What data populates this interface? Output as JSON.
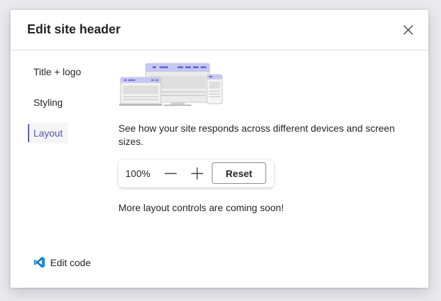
{
  "dialog": {
    "title": "Edit site header",
    "close_icon": "close-icon"
  },
  "nav": {
    "items": [
      {
        "label": "Title + logo",
        "active": false
      },
      {
        "label": "Styling",
        "active": false
      },
      {
        "label": "Layout",
        "active": true
      }
    ],
    "accent_color": "#5b5fc7"
  },
  "layout": {
    "illustration_icon": "responsive-devices-illustration",
    "description": "See how your site responds across different devices and screen sizes.",
    "zoom": {
      "value": "100%",
      "decrease_icon": "minus-icon",
      "increase_icon": "plus-icon",
      "reset_label": "Reset"
    },
    "coming_soon": "More layout controls are coming soon!"
  },
  "footer": {
    "edit_code_label": "Edit code",
    "edit_code_icon": "vscode-icon",
    "edit_code_icon_color": "#0078d4"
  }
}
